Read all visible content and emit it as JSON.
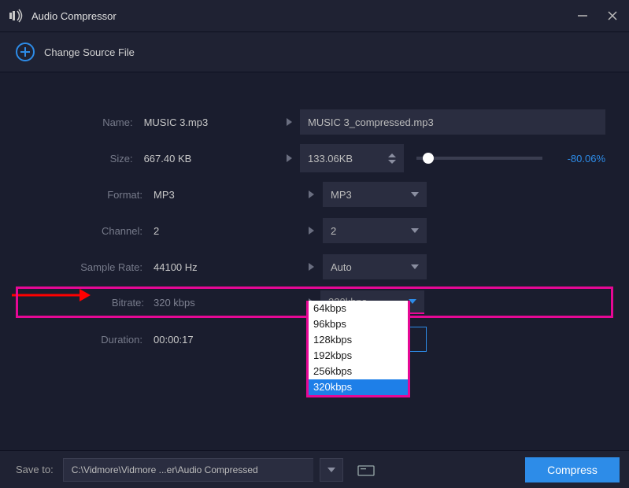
{
  "title": "Audio Compressor",
  "source_bar": {
    "label": "Change Source File"
  },
  "rows": {
    "name": {
      "label": "Name:",
      "source": "MUSIC 3.mp3",
      "output": "MUSIC 3_compressed.mp3"
    },
    "size": {
      "label": "Size:",
      "source": "667.40 KB",
      "target": "133.06KB",
      "pct": "-80.06%"
    },
    "format": {
      "label": "Format:",
      "source": "MP3",
      "selected": "MP3"
    },
    "channel": {
      "label": "Channel:",
      "source": "2",
      "selected": "2"
    },
    "samplerate": {
      "label": "Sample Rate:",
      "source": "44100 Hz",
      "selected": "Auto"
    },
    "bitrate": {
      "label": "Bitrate:",
      "source": "320 kbps",
      "selected": "320kbps",
      "options": [
        "64kbps",
        "96kbps",
        "128kbps",
        "192kbps",
        "256kbps",
        "320kbps"
      ]
    },
    "duration": {
      "label": "Duration:",
      "value": "00:00:17"
    }
  },
  "bottom": {
    "save_label": "Save to:",
    "path": "C:\\Vidmore\\Vidmore ...er\\Audio Compressed",
    "compress": "Compress"
  }
}
